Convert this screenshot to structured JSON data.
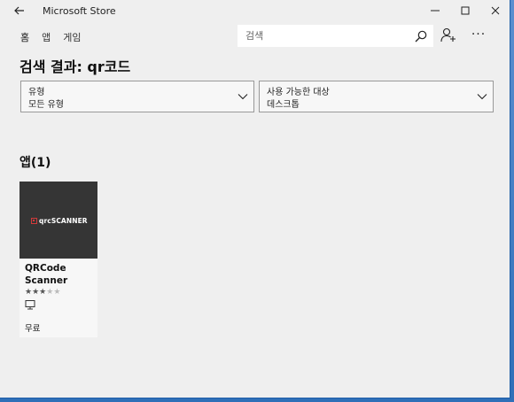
{
  "window": {
    "title": "Microsoft Store"
  },
  "nav": {
    "items": [
      "홈",
      "앱",
      "게임"
    ]
  },
  "search": {
    "placeholder": "검색"
  },
  "page": {
    "title": "검색 결과: qr코드"
  },
  "filters": [
    {
      "label": "유형",
      "value": "모든 유형"
    },
    {
      "label": "사용 가능한 대상",
      "value": "데스크톱"
    }
  ],
  "section": {
    "title": "앱(1)"
  },
  "apps": [
    {
      "thumb_text": "qrcSCANNER",
      "name": "QRCode Scanner",
      "rating": 3,
      "rating_max": 5,
      "platform_icon": "desktop-icon",
      "price": "무료"
    }
  ]
}
